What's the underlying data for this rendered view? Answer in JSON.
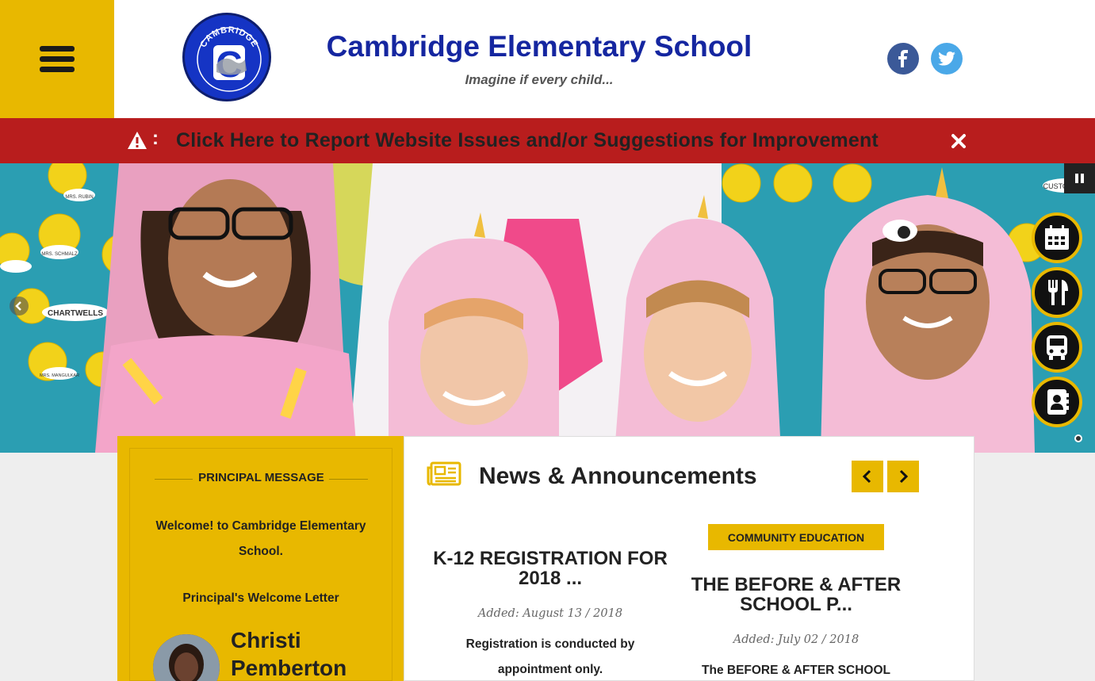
{
  "header": {
    "school_name": "Cambridge Elementary School",
    "tagline": "Imagine if every child...",
    "logo_text": "CAMBRIDGE",
    "logo_letter": "C"
  },
  "alert": {
    "text": "Click Here to Report Website Issues and/or Suggestions for Improvement",
    "separator": ":"
  },
  "hero": {
    "board_labels": [
      "CHARTWELLS",
      "MRS. SCHMALZ",
      "MRS. RUBIN",
      "MRS. MANGULKAR",
      "CUSTODIANS"
    ]
  },
  "principal": {
    "heading": "PRINCIPAL MESSAGE",
    "welcome": "Welcome! to Cambridge Elementary School.",
    "letter_link": "Principal's Welcome Letter",
    "name_first": "Christi",
    "name_last": "Pemberton"
  },
  "news": {
    "heading": "News & Announcements",
    "articles": [
      {
        "category": "",
        "title": "K-12 REGISTRATION FOR 2018 ...",
        "date": "Added: August 13 / 2018",
        "summary": "Registration is conducted by appointment only."
      },
      {
        "category": "COMMUNITY EDUCATION",
        "title": "THE BEFORE & AFTER SCHOOL P...",
        "date": "Added: July 02 / 2018",
        "summary": "The BEFORE & AFTER SCHOOL"
      }
    ]
  },
  "colors": {
    "accent_yellow": "#e8b800",
    "alert_red": "#b81d1d",
    "title_blue": "#1526a0",
    "facebook": "#3b5998",
    "twitter": "#4aa8e8"
  },
  "icons": {
    "menu": "hamburger-icon",
    "facebook": "facebook-icon",
    "twitter": "twitter-icon",
    "alert": "warning-icon",
    "close": "close-icon",
    "pause": "pause-icon",
    "calendar": "calendar-icon",
    "dining": "fork-knife-icon",
    "bus": "bus-icon",
    "directory": "contact-book-icon",
    "news": "newspaper-icon"
  }
}
